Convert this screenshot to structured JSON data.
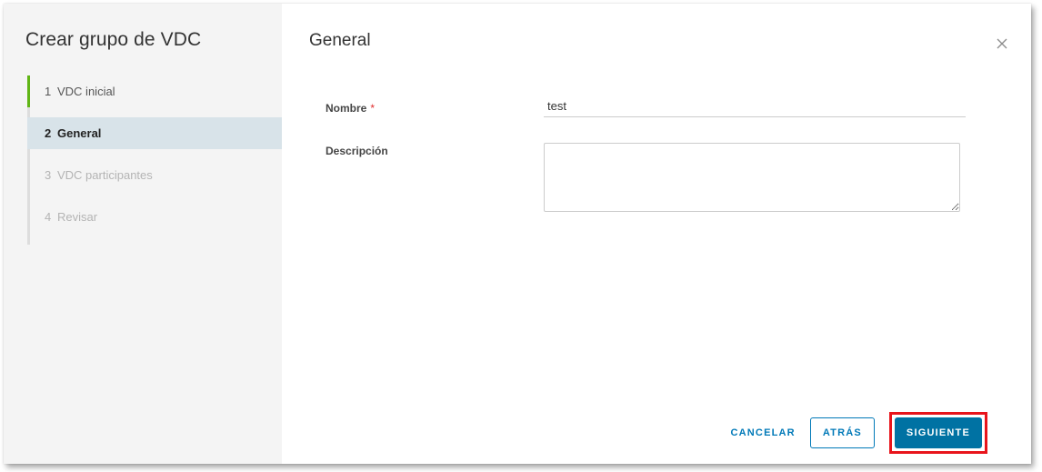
{
  "sidebar": {
    "title": "Crear grupo de VDC",
    "steps": [
      {
        "num": "1",
        "label": "VDC inicial",
        "state": "done"
      },
      {
        "num": "2",
        "label": "General",
        "state": "active"
      },
      {
        "num": "3",
        "label": "VDC participantes",
        "state": "pending"
      },
      {
        "num": "4",
        "label": "Revisar",
        "state": "pending"
      }
    ]
  },
  "main": {
    "title": "General",
    "close_icon": "close-icon",
    "fields": {
      "name": {
        "label": "Nombre",
        "required_mark": "*",
        "value": "test"
      },
      "description": {
        "label": "Descripción",
        "value": ""
      }
    }
  },
  "footer": {
    "cancel_label": "CANCELAR",
    "back_label": "ATRÁS",
    "next_label": "SIGUIENTE"
  },
  "colors": {
    "accent": "#0072a3",
    "done_step": "#60b515",
    "active_step_bg": "#d8e3e9",
    "required": "#e02d2d",
    "highlight": "#e8141b"
  }
}
